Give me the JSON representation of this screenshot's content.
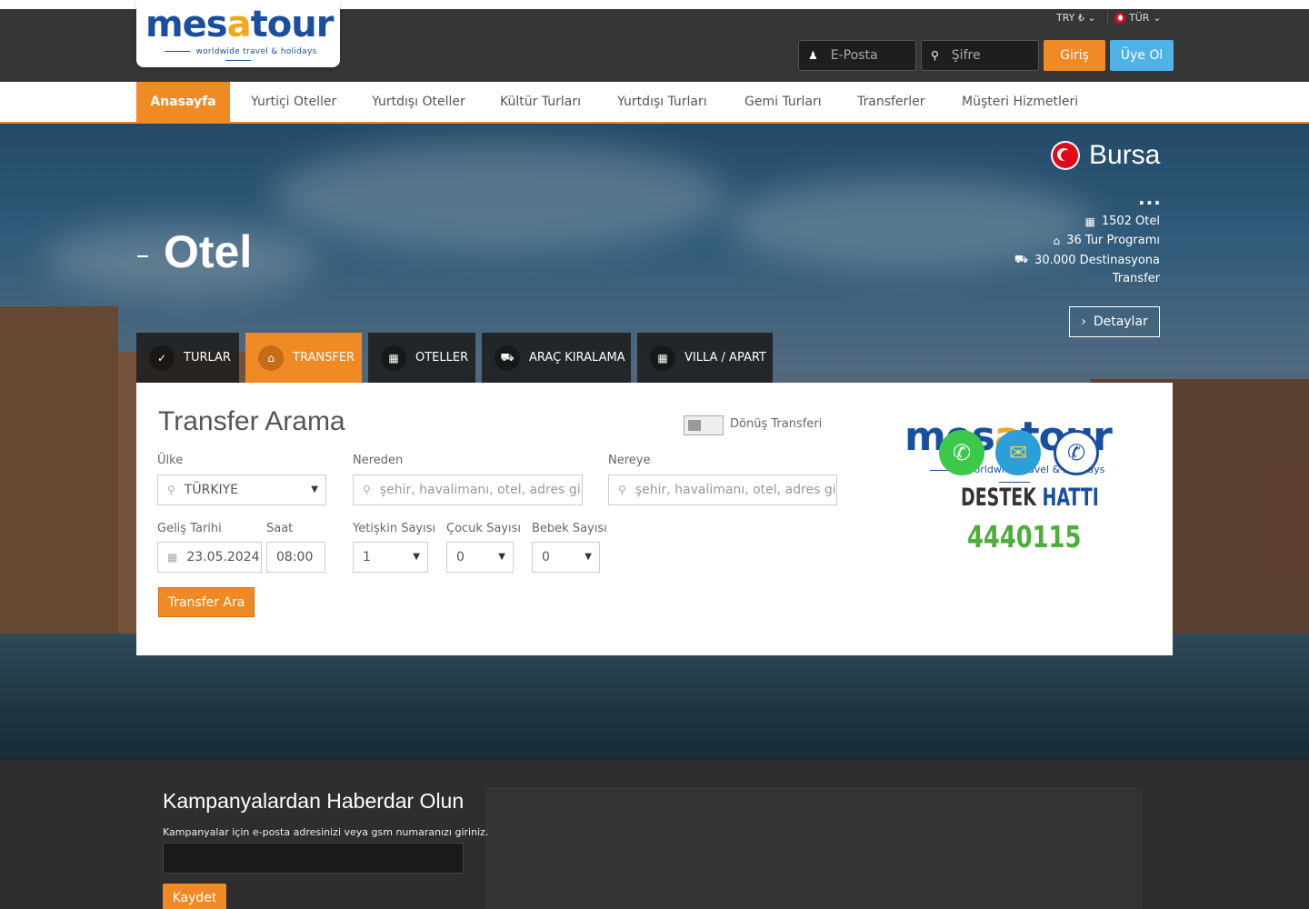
{
  "header": {
    "logo_text": "mesatour",
    "logo_tagline": "worldwide travel & holidays",
    "currency": "TRY ₺",
    "language": "TÜR",
    "email_placeholder": "E-Posta",
    "password_placeholder": "Şifre",
    "login_label": "Giriş",
    "register_label": "Üye Ol"
  },
  "nav": {
    "items": [
      {
        "label": "Anasayfa"
      },
      {
        "label": "Yurtiçi Oteller"
      },
      {
        "label": "Yurtdışı Oteller"
      },
      {
        "label": "Kültür Turları"
      },
      {
        "label": "Yurtdışı Turları"
      },
      {
        "label": "Gemi Turları"
      },
      {
        "label": "Transferler"
      },
      {
        "label": "Müşteri Hizmetleri"
      }
    ]
  },
  "hero": {
    "title": "Otel",
    "city": "Bursa",
    "dots": "...",
    "stats": [
      {
        "icon": "building-icon",
        "text": "1502 Otel"
      },
      {
        "icon": "home-icon",
        "text": "36 Tur Programı"
      },
      {
        "icon": "car-icon",
        "text": "30.000 Destinasyona"
      },
      {
        "icon": "",
        "text": "Transfer"
      }
    ],
    "details_button": "Detaylar"
  },
  "search_tabs": [
    {
      "label": "TURLAR",
      "icon": "bolt-icon"
    },
    {
      "label": "TRANSFER",
      "icon": "home-icon"
    },
    {
      "label": "OTELLER",
      "icon": "building-icon"
    },
    {
      "label": "ARAÇ KIRALAMA",
      "icon": "car-icon"
    },
    {
      "label": "VILLA / APART",
      "icon": "building-icon"
    }
  ],
  "transfer_form": {
    "title": "Transfer Arama",
    "return_toggle_label": "Dönüş Transferi",
    "country_label": "Ülke",
    "country_value": "TÜRKIYE",
    "from_label": "Nereden",
    "from_placeholder": "şehir, havalimanı, otel, adres giri",
    "to_label": "Nereye",
    "to_placeholder": "şehir, havalimanı, otel, adres giri",
    "date_label": "Geliş Tarihi",
    "date_value": "23.05.2024",
    "time_label": "Saat",
    "time_value": "08:00",
    "adults_label": "Yetişkin Sayısı",
    "adults_value": "1",
    "children_label": "Çocuk Sayısı",
    "children_value": "0",
    "infants_label": "Bebek Sayısı",
    "infants_value": "0",
    "submit_label": "Transfer Ara"
  },
  "support": {
    "logo_text": "mesatour",
    "logo_tagline": "worldwide travel & holidays",
    "heading_a": "DESTEK",
    "heading_b": "HATTI",
    "phone": "4440115"
  },
  "newsletter": {
    "title": "Kampanyalardan Haberdar Olun",
    "description": "Kampanyalar için e-posta adresinizi veya gsm numaranızı giriniz.",
    "input_value": "",
    "button_label": "Kaydet"
  },
  "colors": {
    "accent": "#f08a24",
    "brand_blue": "#1a4fa0",
    "brand_yellow": "#f2a81d",
    "register_blue": "#4fb3e8",
    "topbar": "#363636"
  }
}
